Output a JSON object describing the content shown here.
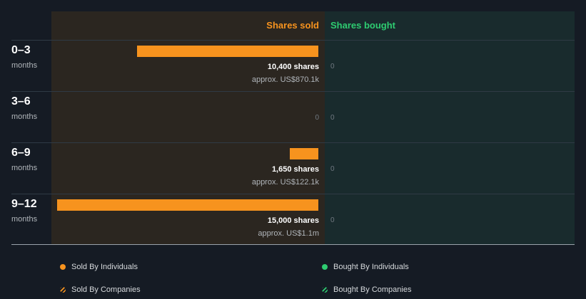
{
  "chart_data": {
    "type": "bar",
    "orientation": "horizontal",
    "categories": [
      {
        "range": "0–3",
        "unit": "months"
      },
      {
        "range": "3–6",
        "unit": "months"
      },
      {
        "range": "6–9",
        "unit": "months"
      },
      {
        "range": "9–12",
        "unit": "months"
      }
    ],
    "series": [
      {
        "name": "Shares sold",
        "values": [
          10400,
          0,
          1650,
          15000
        ],
        "shares_labels": [
          "10,400 shares",
          "",
          "1,650 shares",
          "15,000 shares"
        ],
        "approx_labels": [
          "approx. US$870.1k",
          "",
          "approx. US$122.1k",
          "approx. US$1.1m"
        ],
        "zero_label": "0",
        "color": "#f7931e"
      },
      {
        "name": "Shares bought",
        "values": [
          0,
          0,
          0,
          0
        ],
        "zero_label": "0",
        "color": "#2ecc71"
      }
    ],
    "xlim_sold": [
      0,
      15000
    ]
  },
  "legend": {
    "sold_individuals": "Sold By Individuals",
    "bought_individuals": "Bought By Individuals",
    "sold_companies": "Sold By Companies",
    "bought_companies": "Bought By Companies"
  }
}
